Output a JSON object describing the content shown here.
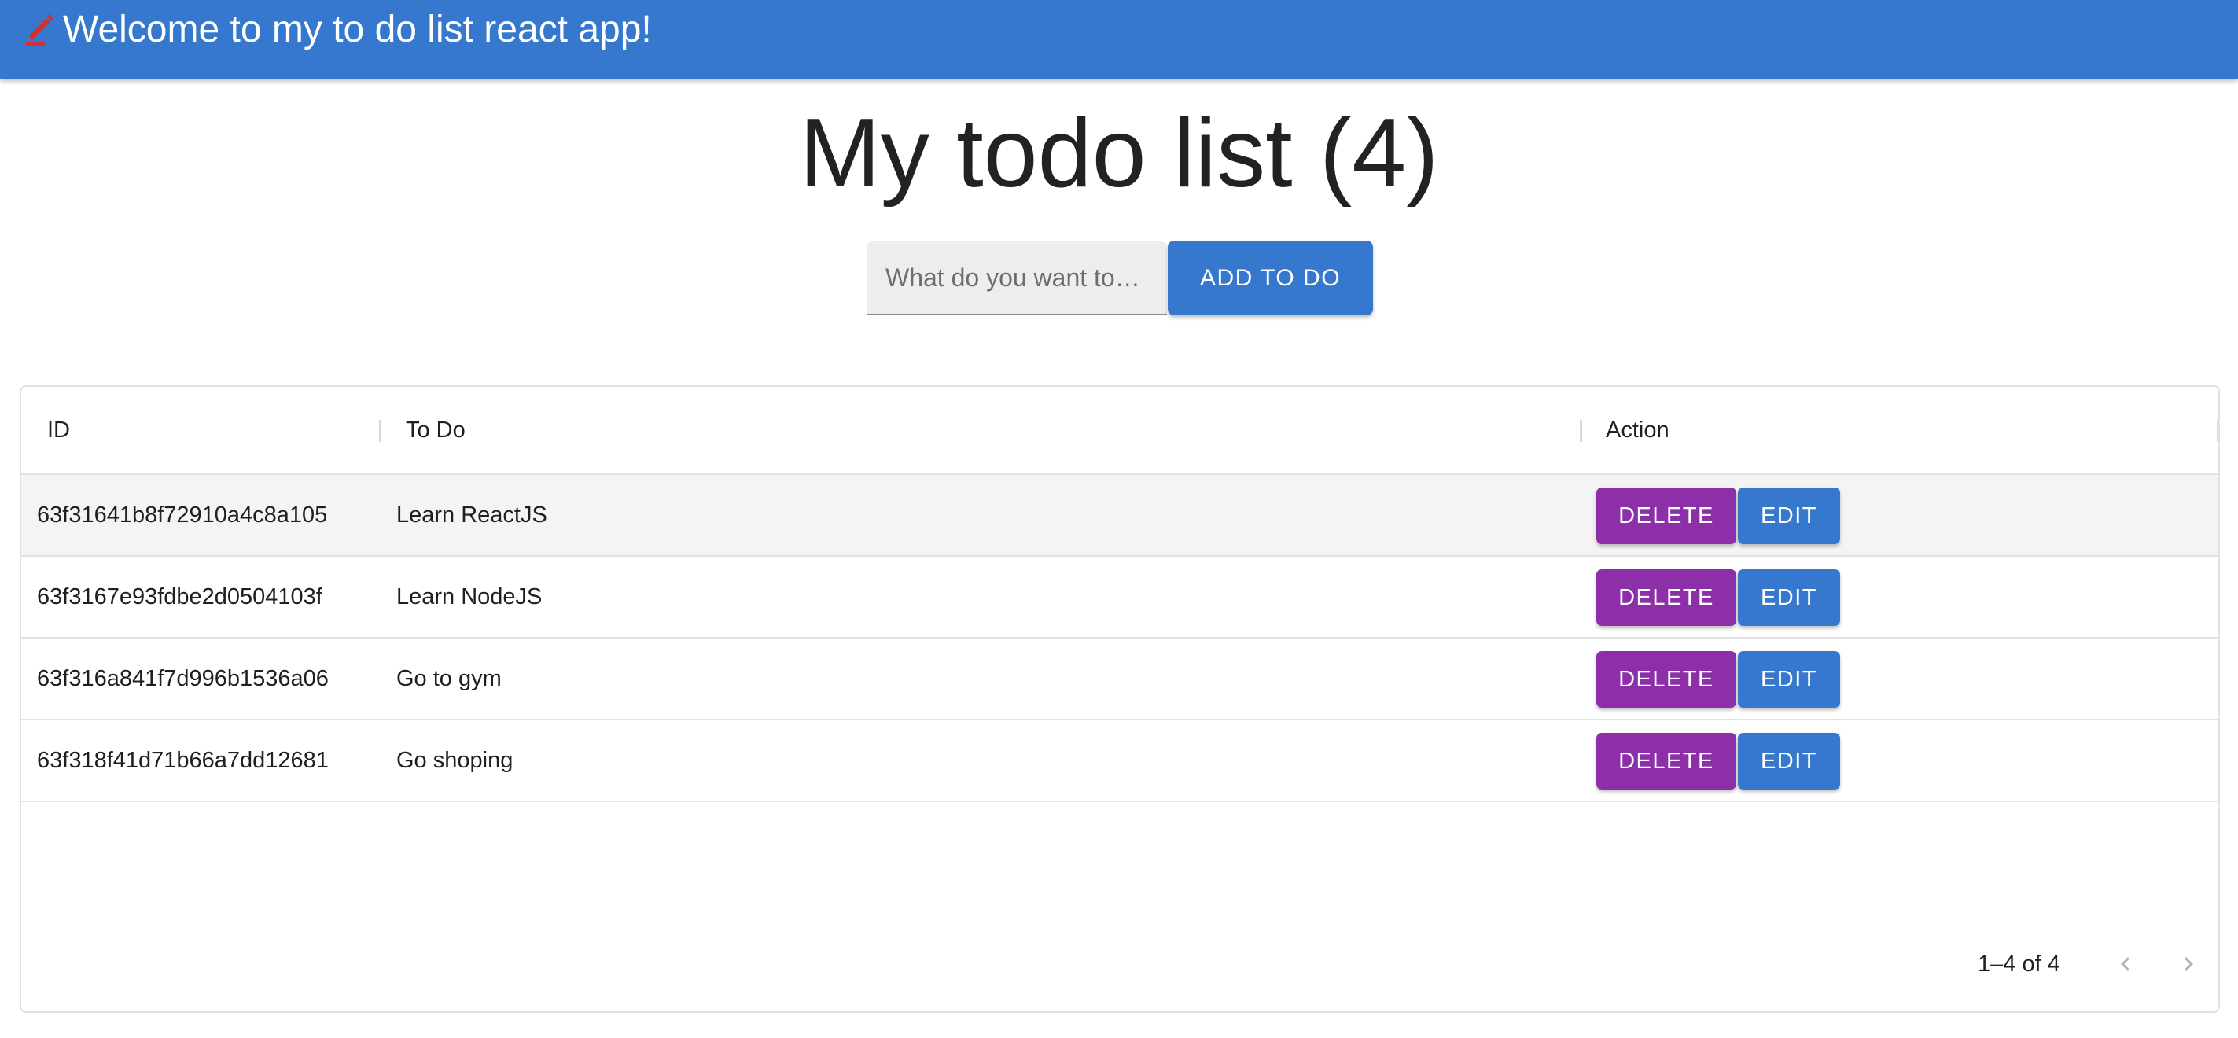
{
  "appbar": {
    "title": "Welcome to my to do list react app!",
    "icon": "edit-pencil-icon",
    "color": "#3578cd"
  },
  "page": {
    "title": "My todo list (4)"
  },
  "form": {
    "input_placeholder": "What do you want to…",
    "input_value": "",
    "add_button_label": "ADD TO DO"
  },
  "grid": {
    "columns": [
      "ID",
      "To Do",
      "Action"
    ],
    "rows": [
      {
        "id": "63f31641b8f72910a4c8a105",
        "todo": "Learn ReactJS",
        "selected": true
      },
      {
        "id": "63f3167e93fdbe2d0504103f",
        "todo": "Learn NodeJS",
        "selected": false
      },
      {
        "id": "63f316a841f7d996b1536a06",
        "todo": "Go to gym",
        "selected": false
      },
      {
        "id": "63f318f41d71b66a7dd12681",
        "todo": "Go shoping",
        "selected": false
      }
    ],
    "delete_label": "DELETE",
    "edit_label": "EDIT",
    "delete_color": "#8e2faa",
    "edit_color": "#3578cd",
    "pagination": {
      "text": "1–4 of 4",
      "prev_icon": "chevron-left-icon",
      "next_icon": "chevron-right-icon",
      "prev_disabled": true,
      "next_disabled": true
    }
  }
}
